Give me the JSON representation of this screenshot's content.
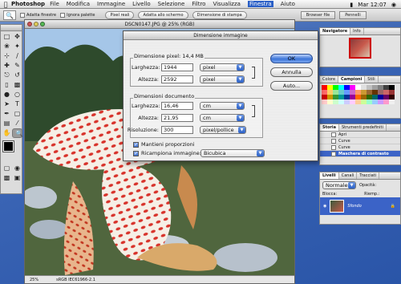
{
  "menubar": {
    "app": "Photoshop",
    "items": [
      "File",
      "Modifica",
      "Immagine",
      "Livello",
      "Selezione",
      "Filtro",
      "Visualizza",
      "Finestra",
      "Aiuto"
    ],
    "active_item": "Finestra",
    "clock": "Mar 12:07"
  },
  "options_bar": {
    "resize_windows_label": "Adatta finestre",
    "ignore_palettes_label": "Ignora palette",
    "actual_pixels_label": "Pixel reali",
    "fit_screen_label": "Adatta allo schermo",
    "print_size_label": "Dimensione di stampa",
    "file_browser_tab": "Browser file",
    "brushes_tab": "Pennelli"
  },
  "document": {
    "title": "DSCN0147.JPG @ 25% (RGB)",
    "zoom": "25%",
    "status": "sRGB IEC61966-2.1"
  },
  "dialog": {
    "title": "Dimensione immagine",
    "pixel_dimensions_label": "Dimensione pixel: 14,4 MB",
    "pixel_width_label": "Larghezza:",
    "pixel_width_value": "1944",
    "pixel_width_unit": "pixel",
    "pixel_height_label": "Altezza:",
    "pixel_height_value": "2592",
    "pixel_height_unit": "pixel",
    "document_size_label": "Dimensioni documento",
    "doc_width_label": "Larghezza:",
    "doc_width_value": "16,46",
    "doc_width_unit": "cm",
    "doc_height_label": "Altezza:",
    "doc_height_value": "21,95",
    "doc_height_unit": "cm",
    "resolution_label": "Risoluzione:",
    "resolution_value": "300",
    "resolution_unit": "pixel/pollice",
    "constrain_label": "Mantieni proporzioni",
    "resample_label": "Ricampiona immagine:",
    "resample_method": "Bicubica",
    "ok_label": "OK",
    "cancel_label": "Annulla",
    "auto_label": "Auto..."
  },
  "navigator": {
    "tabs": [
      "Navigatore",
      "Info"
    ]
  },
  "swatches": {
    "tabs": [
      "Colore",
      "Campioni",
      "Stili"
    ],
    "colors": [
      "#ff0000",
      "#ffff00",
      "#00ff00",
      "#00ffff",
      "#0000ff",
      "#ff00ff",
      "#ffffff",
      "#e0e0e0",
      "#c0c0c0",
      "#a0a0a0",
      "#808080",
      "#404040",
      "#000000",
      "#ff6a6a",
      "#ffcc66",
      "#99e699",
      "#66cccc",
      "#6699ff",
      "#cc66cc",
      "#ff9966",
      "#cc9933",
      "#996633",
      "#663300",
      "#996666",
      "#cc6666",
      "#993333",
      "#cc0000",
      "#cc9900",
      "#339933",
      "#009999",
      "#003399",
      "#990099",
      "#ff6600",
      "#996600",
      "#336600",
      "#006666",
      "#000099",
      "#660066",
      "#330000",
      "#ffcccc",
      "#ffffcc",
      "#ccffcc",
      "#ccffff",
      "#ccccff",
      "#ffccff",
      "#ffcc99",
      "#ccff99",
      "#99ffcc",
      "#99ccff",
      "#cc99ff",
      "#ff99cc",
      "#f0f0f0"
    ]
  },
  "history": {
    "tabs": [
      "Storia",
      "Strumenti predefiniti"
    ],
    "items": [
      "Apri",
      "Curve",
      "Curve",
      "Maschera di contrasto"
    ],
    "active_index": 3
  },
  "layers": {
    "tabs": [
      "Livelli",
      "Canali",
      "Tracciati"
    ],
    "blend_mode": "Normale",
    "opacity_label": "Opacità:",
    "lock_label": "Blocca:",
    "fill_label": "Riemp.:",
    "layer_name": "Sfondo"
  }
}
